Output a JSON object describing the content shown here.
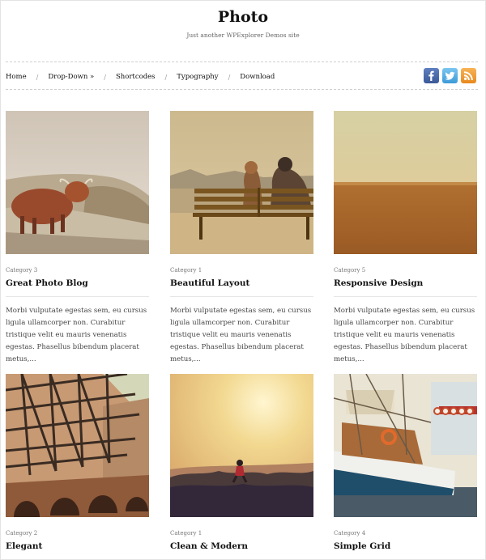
{
  "site": {
    "title": "Photo",
    "description": "Just another WPExplorer Demos site"
  },
  "nav": {
    "items": [
      "Home",
      "Drop-Down »",
      "Shortcodes",
      "Typography",
      "Download"
    ],
    "separator": "/"
  },
  "social": [
    {
      "name": "facebook-icon",
      "color": "#3b5998",
      "glyph": "f"
    },
    {
      "name": "twitter-icon",
      "color": "#4fa9e3",
      "glyph": "t"
    },
    {
      "name": "rss-icon",
      "color": "#f09a2e",
      "glyph": "rss"
    }
  ],
  "posts": [
    {
      "category": "Category 3",
      "title": "Great Photo Blog",
      "excerpt": "Morbi vulputate egestas sem, eu cursus ligula ullamcorper non. Curabitur tristique velit eu mauris venenatis egestas. Phasellus bibendum placerat metus,...",
      "image": "highland-cow-photo"
    },
    {
      "category": "Category 1",
      "title": "Beautiful Layout",
      "excerpt": "Morbi vulputate egestas sem, eu cursus ligula ullamcorper non. Curabitur tristique velit eu mauris venenatis egestas. Phasellus bibendum placerat metus,...",
      "image": "couple-on-bench-photo"
    },
    {
      "category": "Category 5",
      "title": "Responsive Design",
      "excerpt": "Morbi vulputate egestas sem, eu cursus ligula ullamcorper non. Curabitur tristique velit eu mauris venenatis egestas. Phasellus bibendum placerat metus,...",
      "image": "golden-field-photo"
    },
    {
      "category": "Category 2",
      "title": "Elegant",
      "image": "steel-structure-photo"
    },
    {
      "category": "Category 1",
      "title": "Clean & Modern",
      "image": "sunset-runner-photo"
    },
    {
      "category": "Category 4",
      "title": "Simple Grid",
      "image": "harbor-boat-photo"
    }
  ]
}
